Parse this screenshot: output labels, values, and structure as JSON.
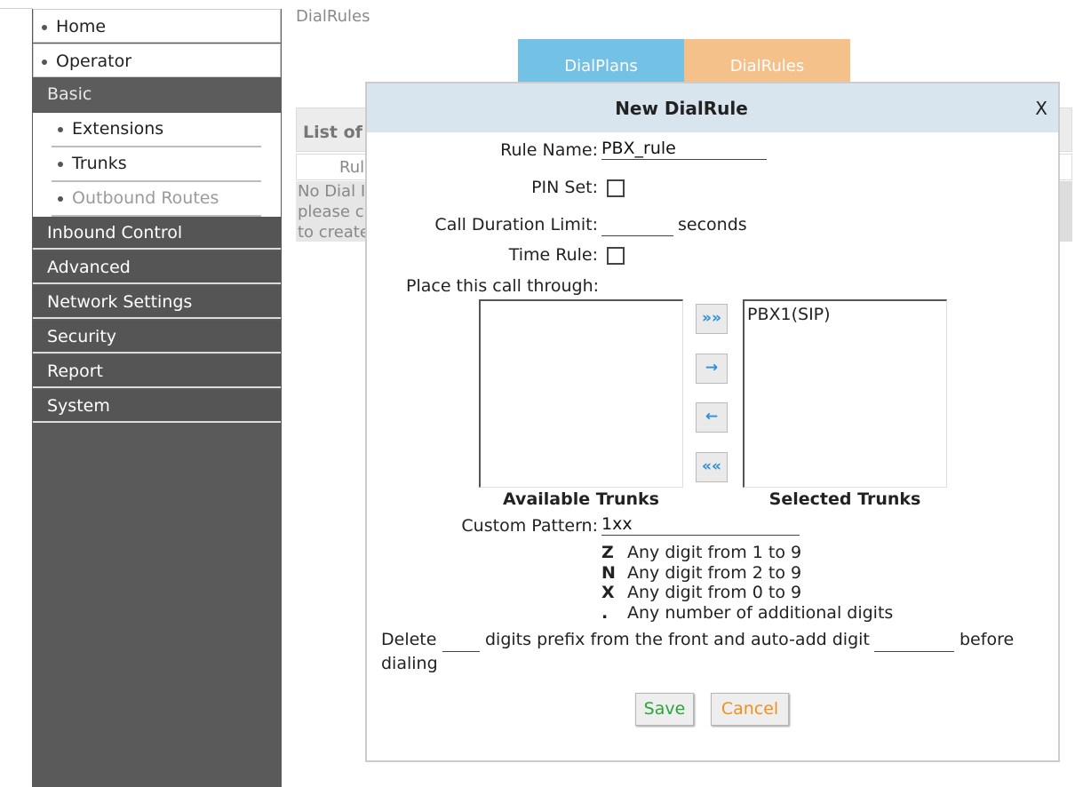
{
  "sidebar": {
    "top_items": [
      "Home",
      "Operator"
    ],
    "basic": {
      "label": "Basic",
      "items": [
        "Extensions",
        "Trunks",
        "Outbound Routes"
      ]
    },
    "sections": [
      "Inbound Control",
      "Advanced",
      "Network Settings",
      "Security",
      "Report",
      "System"
    ]
  },
  "page": {
    "title": "DialRules",
    "tabs": [
      "DialPlans",
      "DialRules"
    ],
    "list_header": "List of",
    "list_column": "Rul",
    "empty_lines": [
      "No Dial I",
      "please c",
      "to create"
    ]
  },
  "modal": {
    "title": "New DialRule",
    "close": "X",
    "rule_name_label": "Rule Name:",
    "rule_name_value": "PBX_rule",
    "pin_set_label": "PIN Set:",
    "call_duration_label": "Call Duration Limit:",
    "call_duration_value": "",
    "seconds_label": "seconds",
    "time_rule_label": "Time Rule:",
    "place_call_label": "Place this call through:",
    "available_trunks": [],
    "selected_trunks": [
      "PBX1(SIP)"
    ],
    "available_caption": "Available Trunks",
    "selected_caption": "Selected Trunks",
    "move_buttons": [
      "»»",
      "→",
      "←",
      "««"
    ],
    "custom_pattern_label": "Custom Pattern:",
    "custom_pattern_value": "1xx",
    "legend": [
      {
        "key": "Z",
        "desc": "Any digit from 1 to 9"
      },
      {
        "key": "N",
        "desc": "Any digit from 2 to 9"
      },
      {
        "key": "X",
        "desc": "Any digit from 0 to 9"
      },
      {
        "key": ".",
        "desc": "Any number of additional digits"
      }
    ],
    "delete_text_1": "Delete",
    "delete_text_2": "digits prefix from the front and auto-add digit",
    "delete_text_3": "before",
    "delete_text_4": "dialing",
    "delete_digits_value": "",
    "auto_add_value": "",
    "save_label": "Save",
    "cancel_label": "Cancel"
  },
  "colors": {
    "save": "#2aa53a",
    "cancel": "#f0901e",
    "tab_dialplans": "#74c1e6",
    "tab_dialrules": "#f5c18a"
  }
}
